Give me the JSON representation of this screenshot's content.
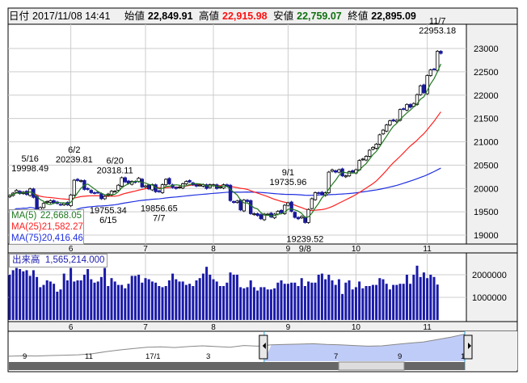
{
  "header": {
    "date_label": "日付",
    "date": "2017/11/08 14:41",
    "open_label": "始値",
    "open": "22,849.91",
    "high_label": "高値",
    "high": "22,915.98",
    "low_label": "安値",
    "low": "22,759.07",
    "close_label": "終値",
    "close": "22,895.09"
  },
  "legend": [
    {
      "label": "MA(5)",
      "value": "22,668.05",
      "color": "#207820"
    },
    {
      "label": "MA(25)",
      "value": "21,582.27",
      "color": "#ff2020"
    },
    {
      "label": "MA(75)",
      "value": "20,416.46",
      "color": "#2030e0"
    }
  ],
  "volume_panel": {
    "label": "出来高",
    "value": "1,565,214.000"
  },
  "colors": {
    "up": "#ffffff",
    "down": "#1a1a9a",
    "volume": "#1a1aa8",
    "ma5": "#207820",
    "ma25": "#ff2020",
    "ma75": "#2030e0",
    "nav_sel": "#c0ccf8"
  },
  "chart_data": {
    "type": "candlestick",
    "price_axis": {
      "ylim": [
        18800,
        23200
      ],
      "ticks": [
        23000,
        22500,
        22000,
        21500,
        21000,
        20500,
        20000,
        19500,
        19000
      ]
    },
    "volume_axis": {
      "ylim": [
        0,
        2800000
      ],
      "ticks": [
        2000000,
        1000000
      ]
    },
    "month_ticks": [
      {
        "label": "6",
        "index": 18
      },
      {
        "label": "7",
        "index": 40
      },
      {
        "label": "8",
        "index": 60
      },
      {
        "label": "9",
        "index": 82
      },
      {
        "label": "10",
        "index": 102
      },
      {
        "label": "11",
        "index": 123
      }
    ],
    "closes": [
      19850,
      19900,
      19960,
      19890,
      19920,
      19870,
      19990,
      19810,
      19550,
      19590,
      19680,
      19720,
      19740,
      19690,
      19680,
      19650,
      19680,
      19650,
      19860,
      20177,
      20170,
      20170,
      19980,
      19980,
      19910,
      19900,
      19910,
      19780,
      19830,
      19880,
      19940,
      19940,
      20070,
      20230,
      20140,
      20110,
      20150,
      20130,
      20220,
      20033,
      20055,
      19990,
      20080,
      19930,
      19930,
      20080,
      20195,
      20100,
      20020,
      20000,
      20030,
      20100,
      20150,
      20140,
      20080,
      20050,
      20070,
      20080,
      20000,
      20080,
      20080,
      20000,
      20030,
      20080,
      20050,
      19740,
      19700,
      19730,
      19540,
      19750,
      19720,
      19460,
      19460,
      19420,
      19350,
      19450,
      19450,
      19390,
      19450,
      19510,
      19480,
      19640,
      19690,
      19510,
      19380,
      19350,
      19400,
      19270,
      19550,
      19780,
      19910,
      19900,
      19870,
      19910,
      20350,
      20400,
      20350,
      20400,
      20270,
      20270,
      20360,
      20350,
      20400,
      20600,
      20630,
      20690,
      20820,
      20880,
      20950,
      21150,
      21250,
      21360,
      21450,
      21450,
      21460,
      21690,
      21700,
      21800,
      21740,
      21820,
      22010,
      22200,
      22050,
      22420,
      22540,
      22550,
      22940,
      22895
    ],
    "volumes": [
      2000000,
      2200000,
      2300000,
      2250000,
      2150000,
      2200000,
      1950000,
      2200000,
      1900000,
      1450000,
      1550000,
      1750000,
      1700000,
      1600000,
      1250000,
      1350000,
      2050000,
      1750000,
      2300000,
      1700000,
      1750000,
      1750000,
      2000000,
      2250000,
      1800000,
      1650000,
      1700000,
      1900000,
      2300000,
      1500000,
      1850000,
      1700000,
      1550000,
      1550000,
      1400000,
      1600000,
      1950000,
      1950000,
      2000000,
      1650000,
      1850000,
      1800000,
      1700000,
      1650000,
      1500000,
      1450000,
      1500000,
      1750000,
      2050000,
      1800000,
      1700000,
      1700000,
      1550000,
      1600000,
      1500000,
      1750000,
      1850000,
      2050000,
      2350000,
      2000000,
      1800000,
      1700000,
      1500000,
      1500000,
      1650000,
      2100000,
      2000000,
      2000000,
      1450000,
      1400000,
      1450000,
      1750000,
      1450000,
      1300000,
      1450000,
      1450000,
      1350000,
      1350000,
      1400000,
      1650000,
      1750000,
      1600000,
      1600000,
      1650000,
      1650000,
      1500000,
      1850000,
      1500000,
      1700000,
      1650000,
      1650000,
      2000000,
      2050000,
      1800000,
      2000000,
      1750000,
      1550000,
      1800000,
      1150000,
      1650000,
      1750000,
      1350000,
      1450000,
      1700000,
      1400000,
      1500000,
      1500000,
      1550000,
      1550000,
      1850000,
      1800000,
      1600000,
      1350000,
      1550000,
      1550000,
      1600000,
      1600000,
      2000000,
      1600000,
      2000000,
      2400000,
      1900000,
      2100000,
      1850000,
      2000000,
      1900000,
      1565214
    ],
    "annotations": [
      {
        "index": 6,
        "date": "5/16",
        "value": "19998.49",
        "pos": "above"
      },
      {
        "index": 19,
        "date": "6/2",
        "value": "20239.81",
        "pos": "above"
      },
      {
        "index": 31,
        "date": "6/20",
        "value": "20318.11",
        "pos": "above"
      },
      {
        "index": 29,
        "date": "6/15",
        "value": "19755.34",
        "pos": "below"
      },
      {
        "index": 44,
        "date": "7/7",
        "value": "19856.65",
        "pos": "below"
      },
      {
        "index": 82,
        "date": "9/1",
        "value": "19735.96",
        "pos": "above"
      },
      {
        "index": 87,
        "date": "9/8",
        "value": "19239.52",
        "pos": "below"
      },
      {
        "index": 126,
        "date": "11/7",
        "value": "22953.18",
        "pos": "above"
      }
    ],
    "navigator": {
      "labels": [
        "9",
        "11",
        "17/1",
        "3",
        "7",
        "9",
        "1"
      ],
      "selection": [
        0.56,
        1.0
      ],
      "series": [
        16500,
        16600,
        16550,
        16700,
        16800,
        16900,
        17200,
        17800,
        18300,
        18700,
        19100,
        19200,
        19000,
        19300,
        19500,
        19300,
        19100,
        19600,
        19400,
        19800,
        19900,
        20000,
        20100,
        19900,
        19800,
        19600,
        19400,
        19500,
        19900,
        20300,
        20600,
        21300,
        22000,
        22900
      ]
    }
  }
}
